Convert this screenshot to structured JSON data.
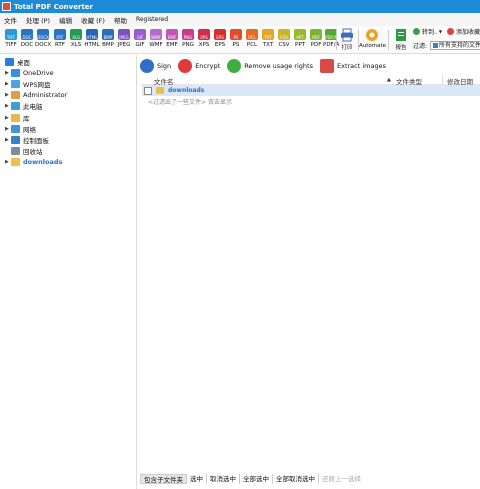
{
  "window": {
    "title": "Total PDF Converter"
  },
  "menu": {
    "items": [
      "文件",
      "处理 (P)",
      "编辑",
      "收藏 (F)",
      "帮助",
      "Registered"
    ]
  },
  "toolbar": {
    "formats": [
      {
        "label": "TIFF",
        "icon_text": "TIFF",
        "color": "#2a9ad6"
      },
      {
        "label": "DOC",
        "icon_text": "DOC",
        "color": "#2a74c8"
      },
      {
        "label": "DOCX",
        "icon_text": "DOCX",
        "color": "#2a74c8"
      },
      {
        "label": "RTF",
        "icon_text": "RTF",
        "color": "#2a74c8"
      },
      {
        "label": "XLS",
        "icon_text": "XLS",
        "color": "#1f9d55"
      },
      {
        "label": "HTML",
        "icon_text": "HTML",
        "color": "#2962b9"
      },
      {
        "label": "BMP",
        "icon_text": "BMP",
        "color": "#2c6fb8"
      },
      {
        "label": "JPEG",
        "icon_text": "JPEG",
        "color": "#7b52c6"
      },
      {
        "label": "GIF",
        "icon_text": "GIF",
        "color": "#9b5cd0"
      },
      {
        "label": "WMF",
        "icon_text": "WMF",
        "color": "#b86ad0"
      },
      {
        "label": "EMF",
        "icon_text": "EMF",
        "color": "#c454b8"
      },
      {
        "label": "PNG",
        "icon_text": "PNG",
        "color": "#c63c8e"
      },
      {
        "label": "XPS",
        "icon_text": "XPS",
        "color": "#d02f4b"
      },
      {
        "label": "EPS",
        "icon_text": "EPS",
        "color": "#d53030"
      },
      {
        "label": "PS",
        "icon_text": "PS",
        "color": "#e04b2c"
      },
      {
        "label": "PCL",
        "icon_text": "PCL",
        "color": "#e56a26"
      },
      {
        "label": "TXT",
        "icon_text": "TXT",
        "color": "#e6a52a"
      },
      {
        "label": "CSV",
        "icon_text": "CSV",
        "color": "#c9b42a"
      },
      {
        "label": "PPT",
        "icon_text": "PPT",
        "color": "#9ab82a"
      },
      {
        "label": "PDF",
        "icon_text": "PDF",
        "color": "#7bb52e"
      },
      {
        "label": "PDF/A",
        "icon_text": "PDF/A",
        "color": "#58a834"
      }
    ],
    "print_label": "打印",
    "automate_label": "Automate",
    "report_label": "报告",
    "convert_to_label": "转到..",
    "add_fav_label": "添加收藏",
    "filter_label": "过滤:",
    "filter_value": "所有支持的文件"
  },
  "tree": {
    "items": [
      {
        "label": "桌面",
        "icon": "desktop-icon",
        "color": "#2a7fd4",
        "arrow": ""
      },
      {
        "label": "OneDrive",
        "icon": "cloud-icon",
        "color": "#3a8ee0",
        "arrow": "▶"
      },
      {
        "label": "WPS网盘",
        "icon": "wps-cloud-icon",
        "color": "#4aa3e8",
        "arrow": "▶"
      },
      {
        "label": "Administrator",
        "icon": "user-icon",
        "color": "#d8a04a",
        "arrow": "▶"
      },
      {
        "label": "此电脑",
        "icon": "computer-icon",
        "color": "#3aa0d8",
        "arrow": "▶"
      },
      {
        "label": "库",
        "icon": "library-icon",
        "color": "#e8b84a",
        "arrow": "▶"
      },
      {
        "label": "网络",
        "icon": "network-icon",
        "color": "#4a90d8",
        "arrow": "▶"
      },
      {
        "label": "控制面板",
        "icon": "control-panel-icon",
        "color": "#3a80c8",
        "arrow": "▶"
      },
      {
        "label": "回收站",
        "icon": "recycle-bin-icon",
        "color": "#7a8ea0",
        "arrow": ""
      },
      {
        "label": "downloads",
        "icon": "folder-icon",
        "color": "#f0c040",
        "arrow": "▶"
      }
    ]
  },
  "actions": [
    {
      "label": "Sign",
      "icon": "sign-icon",
      "color": "#2f6fc4"
    },
    {
      "label": "Encrypt",
      "icon": "encrypt-icon",
      "color": "#e03a3a"
    },
    {
      "label": "Remove usage rights",
      "icon": "remove-rights-icon",
      "color": "#3fae3f"
    },
    {
      "label": "Extract images",
      "icon": "extract-images-icon",
      "color": "#d84a4a"
    }
  ],
  "list": {
    "columns": [
      "文件名",
      "文件类型",
      "修改日期"
    ],
    "rows": [
      {
        "name": "downloads"
      }
    ],
    "hint": "<过滤出了一些文件> 双击显示"
  },
  "bottom": {
    "buttons": [
      "包含子文件夹",
      "选中",
      "取消选中",
      "全部选中",
      "全部取消选中",
      "还原上一选择"
    ]
  }
}
